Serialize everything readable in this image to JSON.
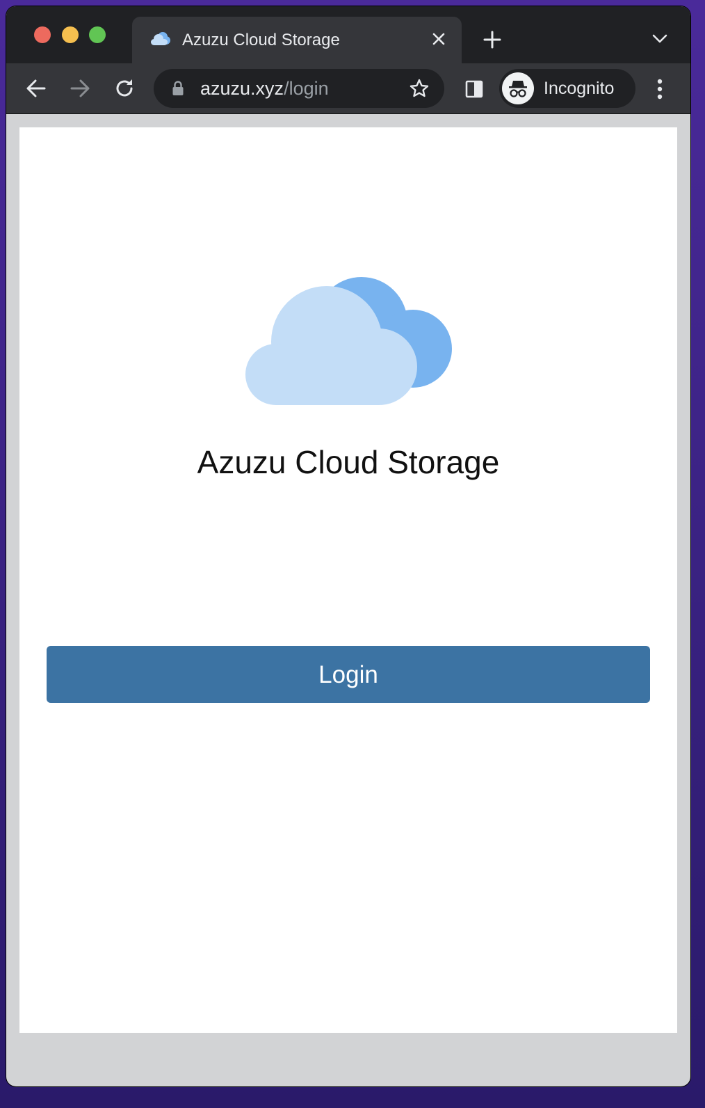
{
  "browser": {
    "tab": {
      "title": "Azuzu Cloud Storage",
      "favicon": "cloud-icon"
    },
    "address_bar": {
      "host": "azuzu.xyz",
      "path": "/login"
    },
    "profile": {
      "label": "Incognito",
      "icon": "incognito-icon"
    },
    "controls": {
      "back": "arrow-left-icon",
      "forward": "arrow-right-icon",
      "reload": "reload-icon",
      "new_tab": "plus-icon",
      "tab_search": "chevron-down-icon",
      "bookmark": "star-icon",
      "side_panel": "side-panel-icon",
      "menu": "kebab-menu-icon"
    }
  },
  "page": {
    "logo": "cloud-logo",
    "app_title": "Azuzu Cloud Storage",
    "login_button_label": "Login"
  },
  "colors": {
    "primary_button": "#3c73a3",
    "cloud_front": "#c3ddf7",
    "cloud_back": "#78b3ef",
    "browser_frame": "#202124",
    "toolbar": "#35363a"
  }
}
